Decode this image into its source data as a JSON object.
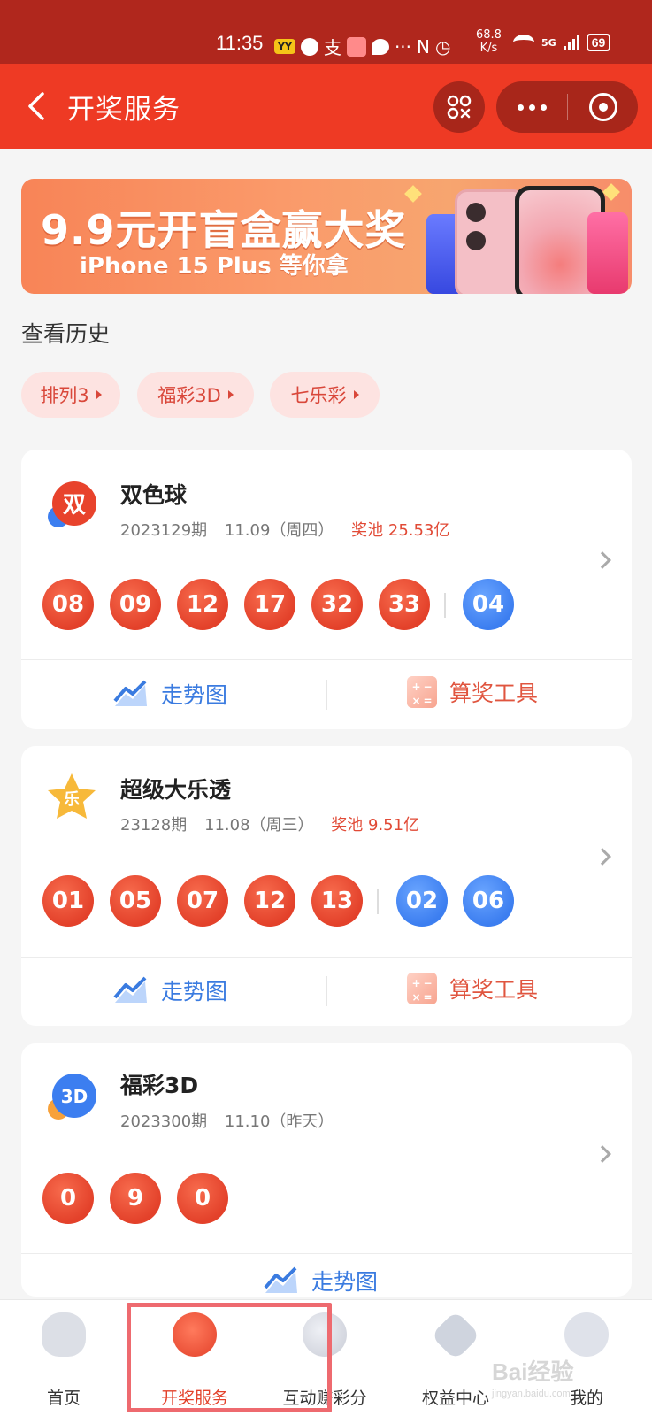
{
  "status_bar": {
    "time": "11:35",
    "app_badge": "YY",
    "alipay_glyph": "支",
    "overflow": "···",
    "net_speed_value": "68.8",
    "net_speed_unit": "K/s",
    "network": "5G",
    "battery": "69"
  },
  "navbar": {
    "title": "开奖服务",
    "back_icon": "chevron-left-icon",
    "scan_icon": "scan-icon",
    "more_icon": "more-dots-icon",
    "close_icon": "target-close-icon",
    "background": "#ee3a24"
  },
  "banner": {
    "title": "9.9元开盲盒赢大奖",
    "subtitle": "iPhone 15 Plus 等你拿"
  },
  "history": {
    "title": "查看历史",
    "chips": [
      "排列3",
      "福彩3D",
      "七乐彩"
    ]
  },
  "lotteries": [
    {
      "name": "双色球",
      "icon_text": "双",
      "issue": "2023129期",
      "date": "11.09（周四）",
      "pool": "奖池 25.53亿",
      "red_balls": [
        "08",
        "09",
        "12",
        "17",
        "32",
        "33"
      ],
      "blue_balls": [
        "04"
      ],
      "trend_label": "走势图",
      "calc_label": "算奖工具"
    },
    {
      "name": "超级大乐透",
      "icon_text": "乐",
      "issue": "23128期",
      "date": "11.08（周三）",
      "pool": "奖池 9.51亿",
      "red_balls": [
        "01",
        "05",
        "07",
        "12",
        "13"
      ],
      "blue_balls": [
        "02",
        "06"
      ],
      "trend_label": "走势图",
      "calc_label": "算奖工具"
    },
    {
      "name": "福彩3D",
      "icon_text": "3D",
      "issue": "2023300期",
      "date": "11.10（昨天）",
      "red_balls": [
        "0",
        "9",
        "0"
      ],
      "trend_label": "走势图"
    }
  ],
  "tabbar": {
    "tabs": [
      {
        "label": "首页",
        "icon": "home-icon"
      },
      {
        "label": "开奖服务",
        "icon": "draw-service-icon",
        "active": true
      },
      {
        "label": "互动赚彩分",
        "icon": "interactive-points-icon"
      },
      {
        "label": "权益中心",
        "icon": "benefits-icon"
      },
      {
        "label": "我的",
        "icon": "profile-icon"
      }
    ]
  },
  "watermark": {
    "brand": "Bai经验",
    "url": "jingyan.baidu.com"
  },
  "colors": {
    "accent_red": "#e3412a",
    "ball_blue": "#3c7ef0",
    "trend_blue": "#3a7be0"
  }
}
